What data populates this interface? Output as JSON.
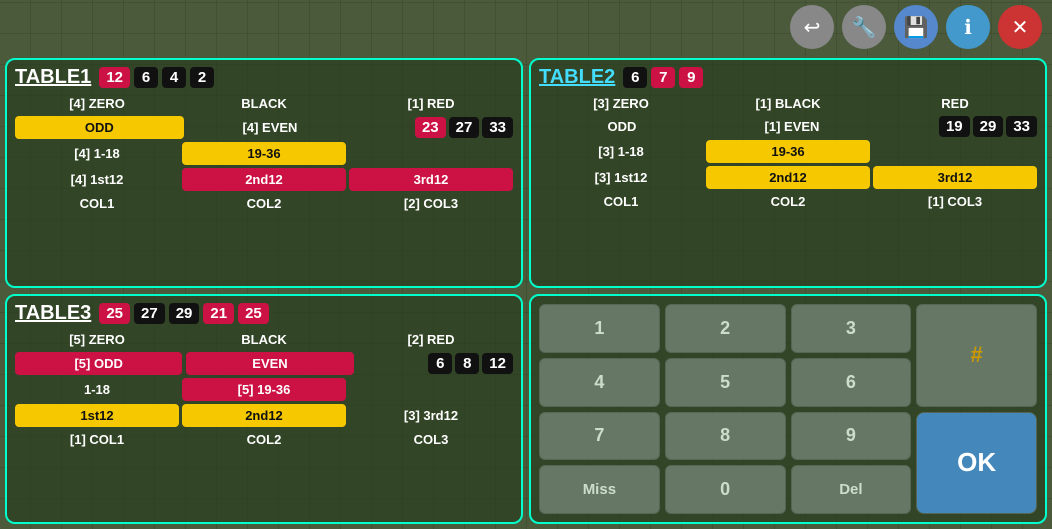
{
  "toolbar": {
    "back_label": "↩",
    "wrench_label": "🔧",
    "save_label": "💾",
    "info_label": "ℹ",
    "close_label": "✕"
  },
  "table1": {
    "title": "TABLE1",
    "badges": [
      "12",
      "6",
      "4",
      "2"
    ],
    "badge_colors": [
      "red",
      "black",
      "black",
      "black"
    ],
    "rows": [
      {
        "col1": "[4] ZERO",
        "col2": "BLACK",
        "col3": "[1] RED"
      },
      {
        "col1": "ODD",
        "col2": "[4] EVEN",
        "col3": ""
      },
      {
        "col1": "[4] 1-18",
        "col2": "19-36",
        "col3": ""
      },
      {
        "col1": "[4] 1st12",
        "col2": "2nd12",
        "col3": "3rd12"
      },
      {
        "col1": "COL1",
        "col2": "COL2",
        "col3": "[2] COL3"
      }
    ],
    "extra_badges": [
      "23",
      "27",
      "33"
    ]
  },
  "table2": {
    "title": "TABLE2",
    "badges": [
      "6",
      "7",
      "9"
    ],
    "badge_colors": [
      "black",
      "red",
      "red"
    ],
    "rows": [
      {
        "col1": "[3] ZERO",
        "col2": "[1] BLACK",
        "col3": "RED"
      },
      {
        "col1": "ODD",
        "col2": "[1] EVEN",
        "col3": ""
      },
      {
        "col1": "[3] 1-18",
        "col2": "19-36",
        "col3": ""
      },
      {
        "col1": "[3] 1st12",
        "col2": "2nd12",
        "col3": "3rd12"
      },
      {
        "col1": "COL1",
        "col2": "COL2",
        "col3": "[1] COL3"
      }
    ],
    "extra_badges": [
      "19",
      "29",
      "33"
    ]
  },
  "table3": {
    "title": "TABLE3",
    "badges": [
      "25",
      "27",
      "29",
      "21",
      "25"
    ],
    "badge_colors": [
      "red",
      "black",
      "black",
      "red",
      "red"
    ],
    "rows": [
      {
        "col1": "[5] ZERO",
        "col2": "BLACK",
        "col3": "[2] RED"
      },
      {
        "col1": "[5] ODD",
        "col2": "EVEN",
        "col3": ""
      },
      {
        "col1": "1-18",
        "col2": "[5] 19-36",
        "col3": ""
      },
      {
        "col1": "1st12",
        "col2": "2nd12",
        "col3": "[3] 3rd12"
      },
      {
        "col1": "[1] COL1",
        "col2": "COL2",
        "col3": "COL3"
      }
    ],
    "extra_badges": [
      "6",
      "8",
      "12"
    ]
  },
  "numpad": {
    "buttons": [
      [
        "1",
        "2",
        "3",
        "#"
      ],
      [
        "4",
        "5",
        "6",
        ""
      ],
      [
        "7",
        "8",
        "9",
        ""
      ],
      [
        "Miss",
        "0",
        "Del",
        ""
      ]
    ],
    "ok_label": "OK"
  }
}
